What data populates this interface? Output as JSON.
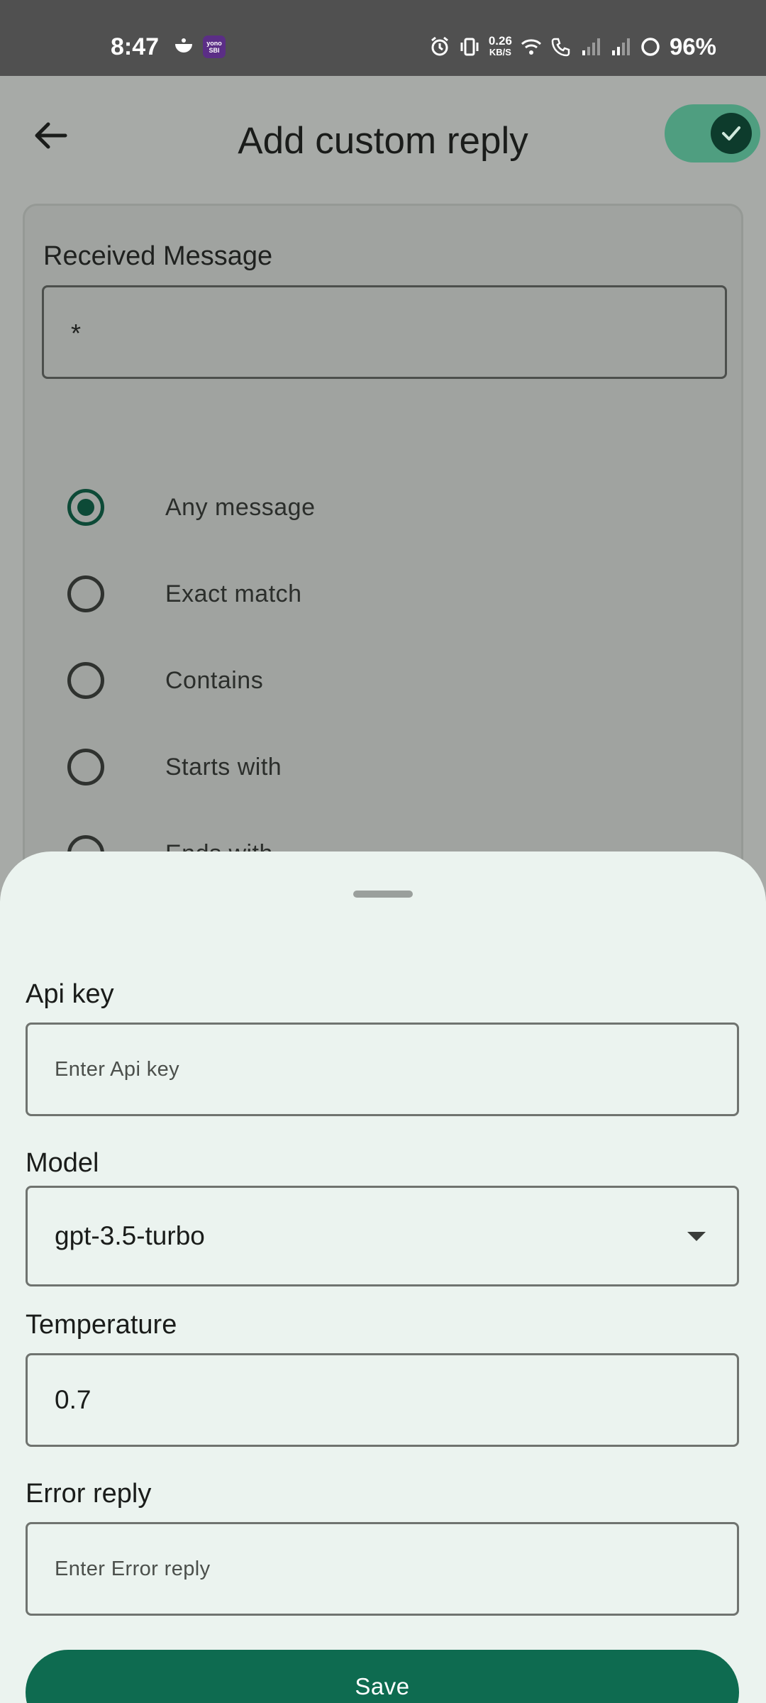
{
  "status_bar": {
    "time": "8:47",
    "app_badge": "yono SBI",
    "net_speed_value": "0.26",
    "net_speed_unit": "KB/S",
    "battery": "96%",
    "icons": [
      "alarm-icon",
      "vibrate-icon",
      "wifi-icon",
      "wifi-call-icon",
      "signal-icon",
      "signal-icon",
      "battery-icon"
    ]
  },
  "header": {
    "title": "Add custom reply",
    "toggle_on": true
  },
  "received_message": {
    "label": "Received Message",
    "value": "*",
    "options": [
      {
        "label": "Any message",
        "selected": true
      },
      {
        "label": "Exact match",
        "selected": false
      },
      {
        "label": "Contains",
        "selected": false
      },
      {
        "label": "Starts with",
        "selected": false
      },
      {
        "label": "Ends with",
        "selected": false
      }
    ]
  },
  "sheet": {
    "api_key": {
      "label": "Api key",
      "placeholder": "Enter Api key",
      "value": ""
    },
    "model": {
      "label": "Model",
      "value": "gpt-3.5-turbo"
    },
    "temperature": {
      "label": "Temperature",
      "value": "0.7"
    },
    "error_reply": {
      "label": "Error reply",
      "placeholder": "Enter Error reply",
      "value": ""
    },
    "save_label": "Save"
  },
  "colors": {
    "accent": "#0e6b50",
    "toggle_track": "#4f9e80",
    "sheet_bg": "#ebf3ef",
    "scrim_bg": "#a7aaa7"
  }
}
